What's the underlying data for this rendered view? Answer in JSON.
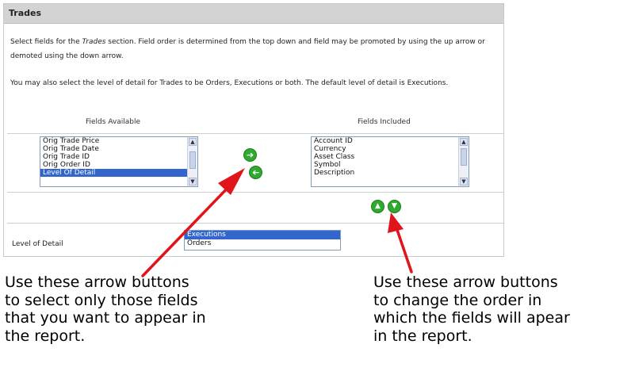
{
  "panel": {
    "title": "Trades",
    "intro_pre": "Select fields for the ",
    "intro_em": "Trades",
    "intro_post": " section. Field order is determined from the top down and field may be promoted by using the up arrow or demoted using the down arrow.",
    "detail_text": "You may also select the level of detail for Trades to be Orders, Executions or both. The default level of detail is Executions."
  },
  "fields_available": {
    "header": "Fields Available",
    "items": [
      "Orig Trade Price",
      "Orig Trade Date",
      "Orig Trade ID",
      "Orig Order ID",
      "Level Of Detail"
    ],
    "selected_index": 4
  },
  "fields_included": {
    "header": "Fields Included",
    "items": [
      "Account ID",
      "Currency",
      "Asset Class",
      "Symbol",
      "Description"
    ]
  },
  "buttons": {
    "add_glyph": "➔",
    "remove_glyph": "➔",
    "up_glyph": "▲",
    "down_glyph": "▼"
  },
  "level_of_detail": {
    "label": "Level of Detail",
    "options": [
      "Executions",
      "Orders"
    ],
    "selected_index": 0
  },
  "captions": {
    "left": "Use these arrow buttons\nto select only those fields\nthat you want to appear in\nthe report.",
    "right": "Use these arrow buttons\nto change the order in\nwhich the fields will apear\nin the report."
  },
  "colors": {
    "header_bg": "#d3d3d3",
    "selection": "#3366cc",
    "button_green": "#2faa2f",
    "arrow_red": "#e0141b"
  }
}
